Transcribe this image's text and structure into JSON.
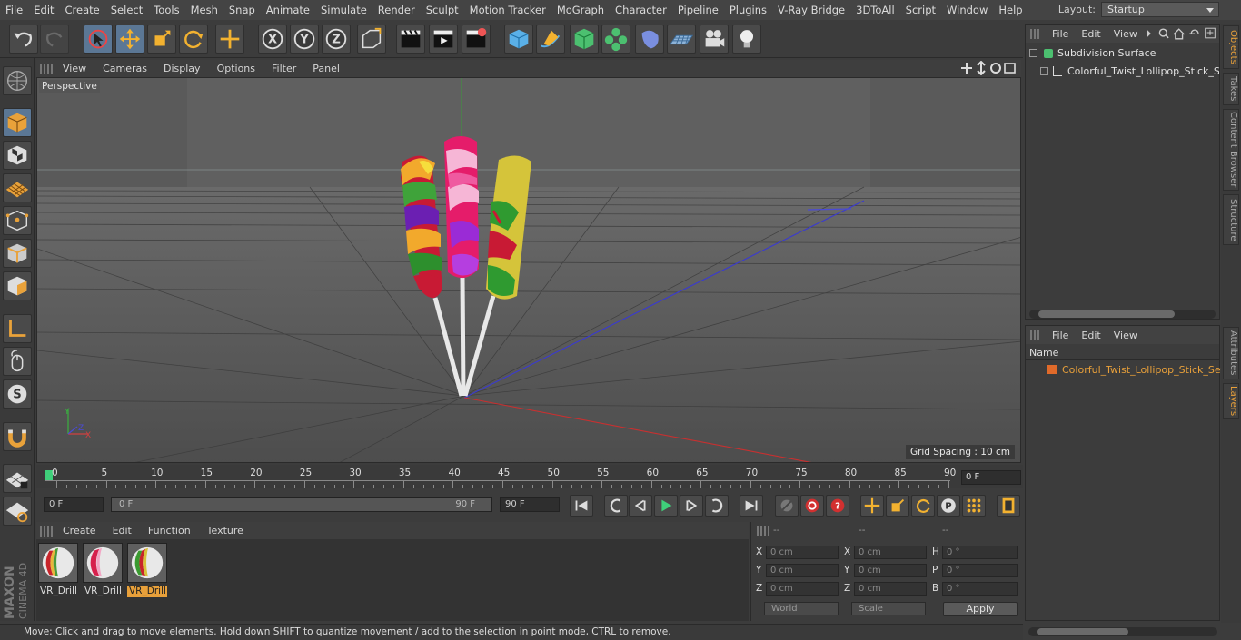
{
  "menubar": [
    "File",
    "Edit",
    "Create",
    "Select",
    "Tools",
    "Mesh",
    "Snap",
    "Animate",
    "Simulate",
    "Render",
    "Sculpt",
    "Motion Tracker",
    "MoGraph",
    "Character",
    "Pipeline",
    "Plugins",
    "V-Ray Bridge",
    "3DToAll",
    "Script",
    "Window",
    "Help"
  ],
  "layout": {
    "label": "Layout:",
    "value": "Startup"
  },
  "viewport": {
    "menu": [
      "View",
      "Cameras",
      "Display",
      "Options",
      "Filter",
      "Panel"
    ],
    "label": "Perspective",
    "grid_spacing": "Grid Spacing : 10 cm",
    "axis_y": "Y",
    "axis_z": "Z",
    "axis_x": "X"
  },
  "timeline": {
    "ticks": [
      "0",
      "5",
      "10",
      "15",
      "20",
      "25",
      "30",
      "35",
      "40",
      "45",
      "50",
      "55",
      "60",
      "65",
      "70",
      "75",
      "80",
      "85",
      "90"
    ],
    "current_frame": "0 F"
  },
  "anim": {
    "start_field": "0 F",
    "range_left": "0 F",
    "range_right": "90 F",
    "end_field": "90 F"
  },
  "materials": {
    "menu": [
      "Create",
      "Edit",
      "Function",
      "Texture"
    ],
    "items": [
      {
        "name": "VR_Drill",
        "selected": false
      },
      {
        "name": "VR_Drill",
        "selected": false
      },
      {
        "name": "VR_Drill",
        "selected": true
      }
    ]
  },
  "coords": {
    "headers": [
      "--",
      "--",
      "--"
    ],
    "rows": [
      {
        "l1": "X",
        "v1": "0 cm",
        "l2": "X",
        "v2": "0 cm",
        "l3": "H",
        "v3": "0 °"
      },
      {
        "l1": "Y",
        "v1": "0 cm",
        "l2": "Y",
        "v2": "0 cm",
        "l3": "P",
        "v3": "0 °"
      },
      {
        "l1": "Z",
        "v1": "0 cm",
        "l2": "Z",
        "v2": "0 cm",
        "l3": "B",
        "v3": "0 °"
      }
    ],
    "world": "World",
    "scale": "Scale",
    "apply": "Apply"
  },
  "status": "Move: Click and drag to move elements. Hold down SHIFT to quantize movement / add to the selection in point mode, CTRL to remove.",
  "objects": {
    "menu": [
      "File",
      "Edit",
      "View"
    ],
    "items": [
      "Subdivision Surface",
      "Colorful_Twist_Lollipop_Stick_Set"
    ]
  },
  "layers": {
    "menu": [
      "File",
      "Edit",
      "View"
    ],
    "header": "Name",
    "item": "Colorful_Twist_Lollipop_Stick_Set"
  },
  "side_tabs": [
    "Objects",
    "Takes",
    "Content Browser",
    "Structure",
    "Attributes",
    "Layers"
  ],
  "brand": {
    "maker": "MAXON",
    "product": "CINEMA 4D"
  },
  "colors": {
    "accent": "#e8a03a",
    "highlight": "#5b7795"
  }
}
